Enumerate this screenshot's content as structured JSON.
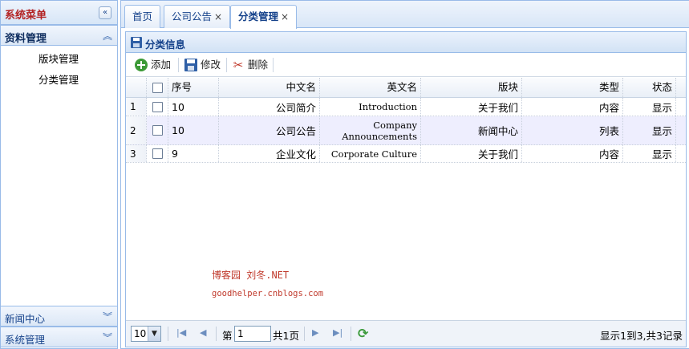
{
  "sidebar": {
    "title": "系统菜单",
    "collapse_icon": "«",
    "sections": [
      {
        "label": "资料管理",
        "arrow": "︽",
        "items": [
          "版块管理",
          "分类管理"
        ]
      },
      {
        "label": "新闻中心",
        "arrow": "︾"
      },
      {
        "label": "系统管理",
        "arrow": "︾"
      }
    ]
  },
  "tabs": [
    {
      "label": "首页"
    },
    {
      "label": "公司公告",
      "close": "×"
    },
    {
      "label": "分类管理",
      "close": "×"
    }
  ],
  "panel": {
    "title": "分类信息",
    "toolbar": {
      "add": "添加",
      "edit": "修改",
      "delete": "删除"
    }
  },
  "grid": {
    "columns": [
      "序号",
      "中文名",
      "英文名",
      "版块",
      "类型",
      "状态"
    ],
    "rows": [
      {
        "num": "1",
        "order": "10",
        "cn": "公司简介",
        "en": "Introduction",
        "board": "关于我们",
        "type": "内容",
        "status": "显示"
      },
      {
        "num": "2",
        "order": "10",
        "cn": "公司公告",
        "en": "Company Announcements",
        "board": "新闻中心",
        "type": "列表",
        "status": "显示"
      },
      {
        "num": "3",
        "order": "9",
        "cn": "企业文化",
        "en": "Corporate Culture",
        "board": "关于我们",
        "type": "内容",
        "status": "显示"
      }
    ]
  },
  "watermark": {
    "line1": "博客园 刘冬.NET",
    "line2": "goodhelper.cnblogs.com"
  },
  "pager": {
    "page_size": "10",
    "page_prefix": "第",
    "page_value": "1",
    "page_suffix": "共1页",
    "info": "显示1到3,共3记录"
  },
  "colors": {
    "accent": "#15428b",
    "border": "#99bbe8",
    "title_red": "#b32222"
  }
}
